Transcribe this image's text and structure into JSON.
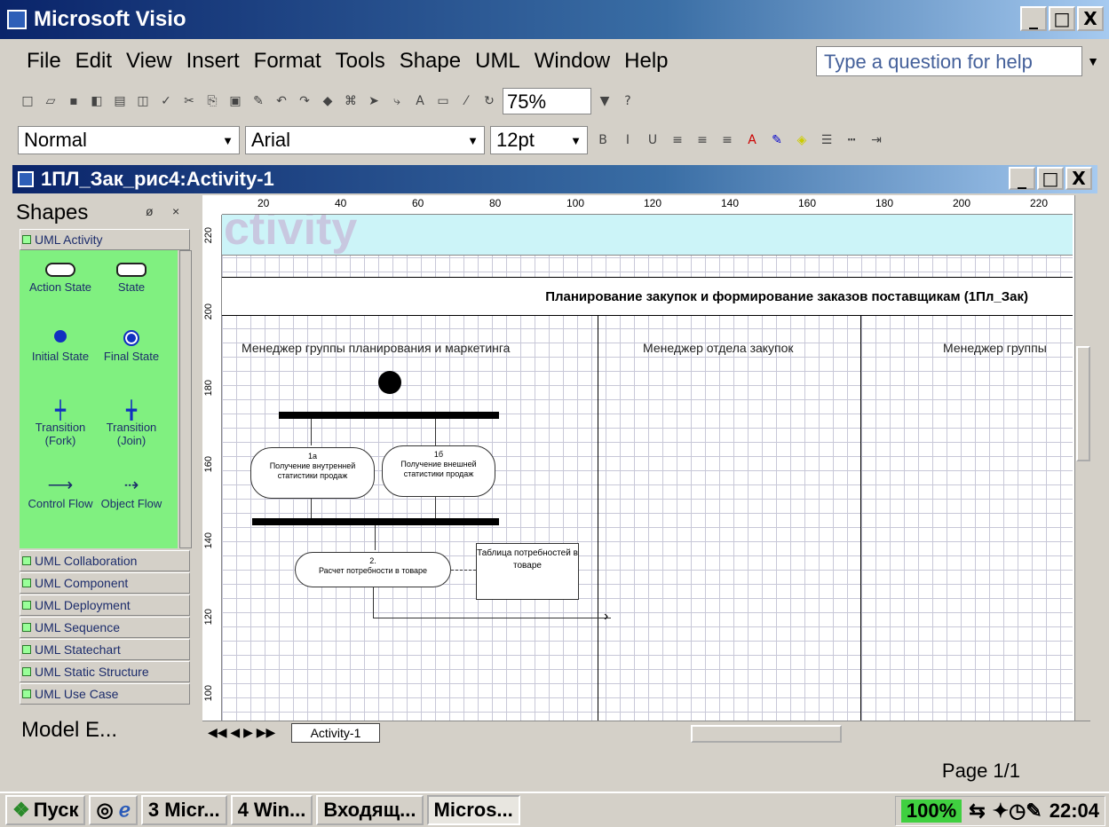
{
  "app": {
    "title": "Microsoft Visio",
    "min": "_",
    "max": "□",
    "close": "X"
  },
  "menu": [
    "File",
    "Edit",
    "View",
    "Insert",
    "Format",
    "Tools",
    "Shape",
    "UML",
    "Window",
    "Help"
  ],
  "help_placeholder": "Type a question for help",
  "toolbar": {
    "zoom": "75%"
  },
  "format": {
    "style": "Normal",
    "font": "Arial",
    "size": "12pt"
  },
  "document": {
    "title": "1ПЛ_Зак_рис4:Activity-1"
  },
  "shapes": {
    "header": "Shapes",
    "active_stencil": "UML Activity",
    "items": [
      {
        "label": "Action State"
      },
      {
        "label": "State"
      },
      {
        "label": "Initial State"
      },
      {
        "label": "Final State"
      },
      {
        "label": "Transition (Fork)"
      },
      {
        "label": "Transition (Join)"
      },
      {
        "label": "Control Flow"
      },
      {
        "label": "Object Flow"
      }
    ],
    "stencils": [
      "UML Collaboration",
      "UML Component",
      "UML Deployment",
      "UML Sequence",
      "UML Statechart",
      "UML Static Structure",
      "UML Use Case"
    ]
  },
  "model_explorer": "Model E...",
  "ruler": {
    "h": [
      "20",
      "40",
      "60",
      "80",
      "100",
      "120",
      "140",
      "160",
      "180",
      "200",
      "220"
    ],
    "v": [
      "220",
      "200",
      "180",
      "160",
      "140",
      "120",
      "100"
    ]
  },
  "diagram": {
    "band_text": "ctivity",
    "pool_title": "Планирование закупок и формирование заказов поставщикам (1Пл_Зак)",
    "lanes": [
      "Менеджер группы планирования и маркетинга",
      "Менеджер отдела закупок",
      "Менеджер группы"
    ],
    "activities": [
      {
        "num": "1а",
        "text": "Получение внутренней статистики продаж"
      },
      {
        "num": "1б",
        "text": "Получение внешней статистики продаж"
      },
      {
        "num": "2.",
        "text": "Расчет потребности в товаре"
      }
    ],
    "object": "Таблица потребностей в товаре"
  },
  "tab": "Activity-1",
  "status": {
    "page": "Page 1/1"
  },
  "taskbar": {
    "start": "Пуск",
    "tasks": [
      "3 Micr...",
      "4 Win...",
      "Входящ...",
      "Micros..."
    ],
    "percent": "100%",
    "time": "22:04"
  }
}
